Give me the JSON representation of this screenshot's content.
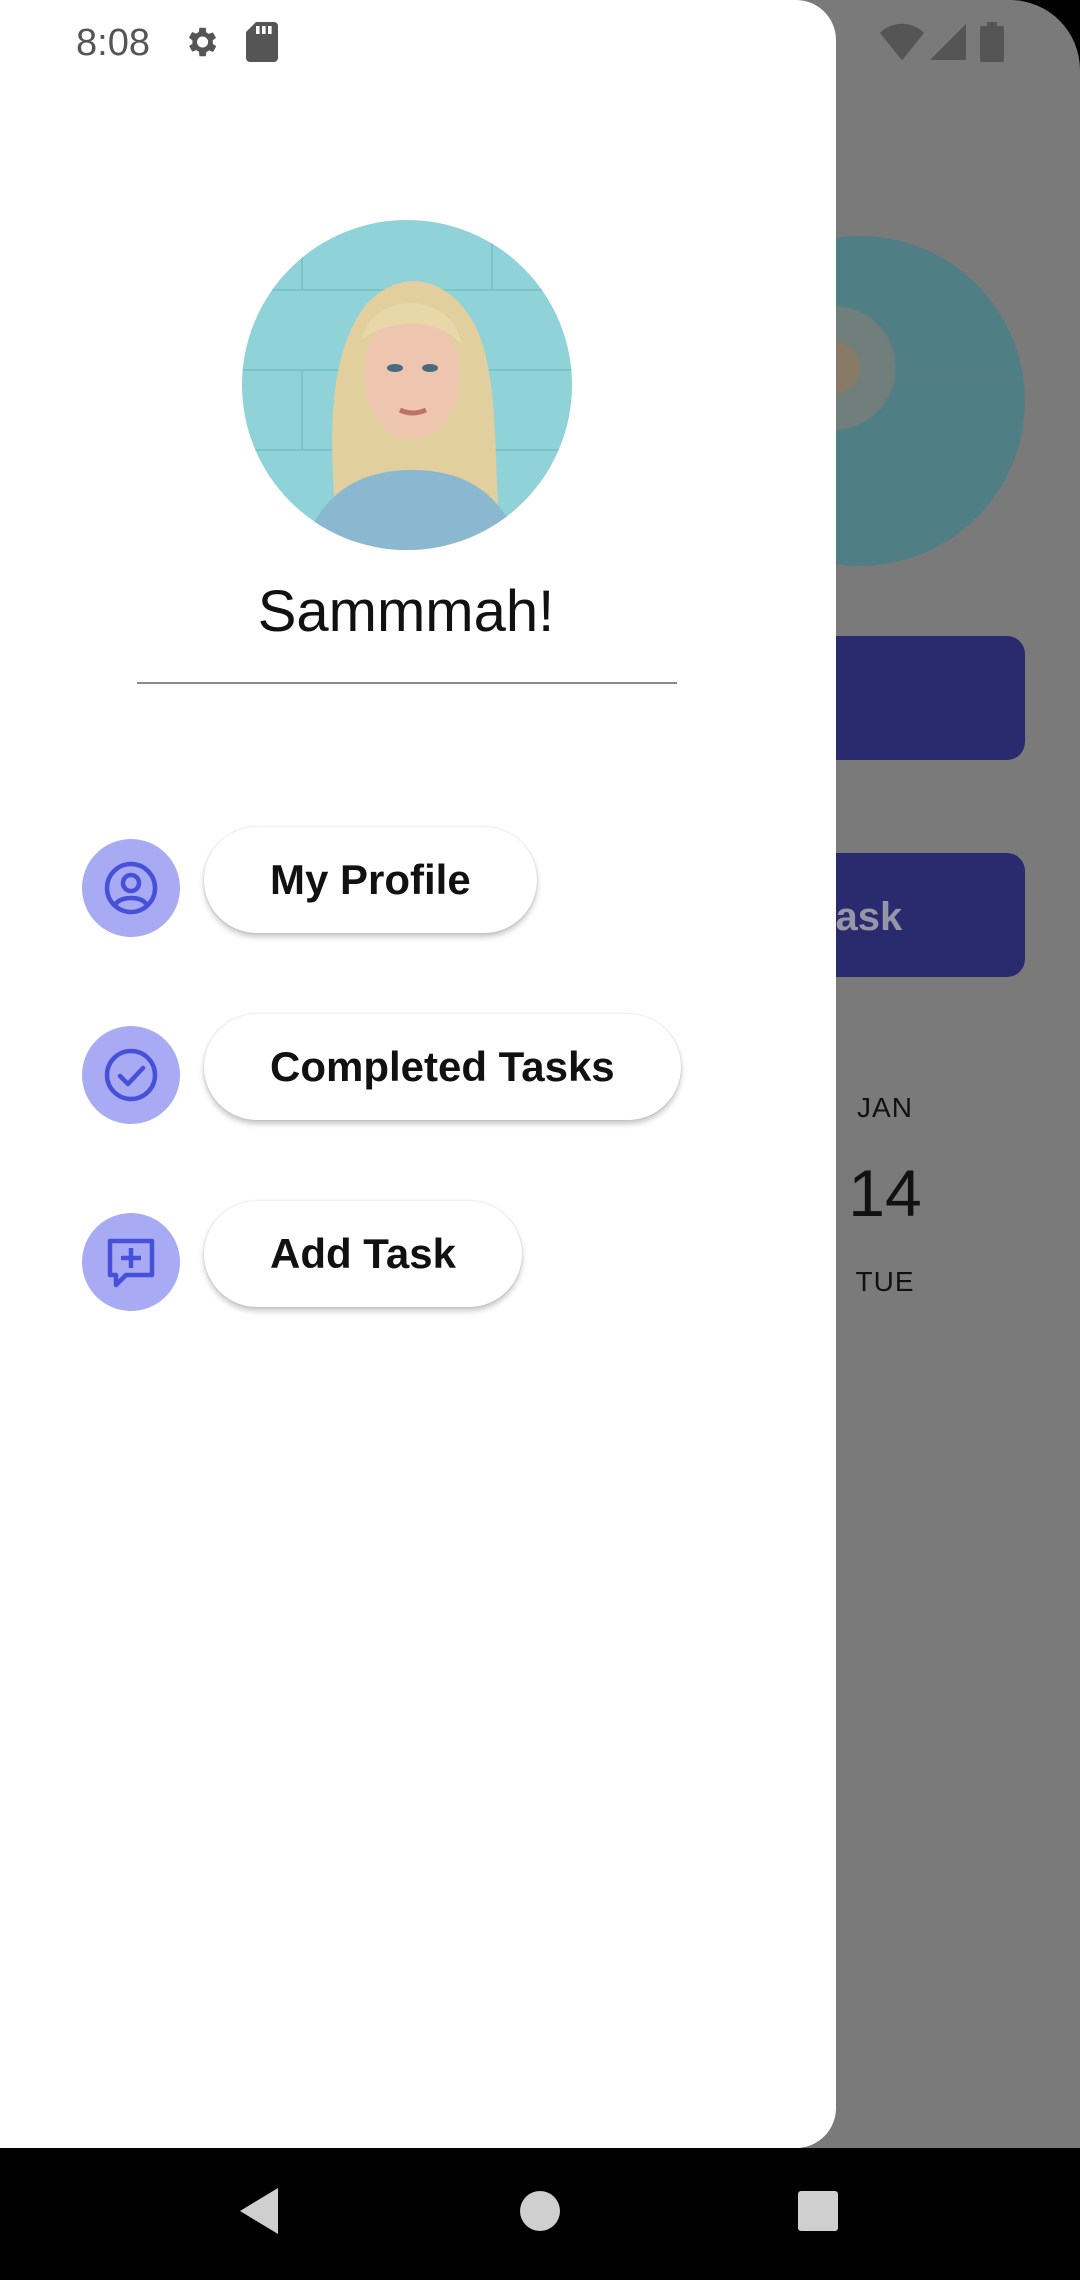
{
  "status_bar": {
    "time": "8:08",
    "icons": [
      "settings-icon",
      "sd-card-icon",
      "wifi-icon",
      "signal-icon",
      "battery-icon"
    ]
  },
  "drawer": {
    "user_name": "Sammmah!",
    "menu": [
      {
        "label": "My Profile",
        "icon": "profile-icon"
      },
      {
        "label": "Completed Tasks",
        "icon": "check-circle-icon"
      },
      {
        "label": "Add Task",
        "icon": "add-task-icon"
      }
    ]
  },
  "background_app": {
    "button_label_partial": "l task",
    "date": {
      "month": "JAN",
      "day": "14",
      "weekday": "TUE"
    }
  },
  "colors": {
    "accent": "#a8aaf3",
    "icon_blue": "#4650d8",
    "bg_button": "#2a2a6e",
    "scrim": "#7a7a7a"
  },
  "nav_bar": {
    "buttons": [
      "back-icon",
      "home-icon",
      "recents-icon"
    ]
  }
}
